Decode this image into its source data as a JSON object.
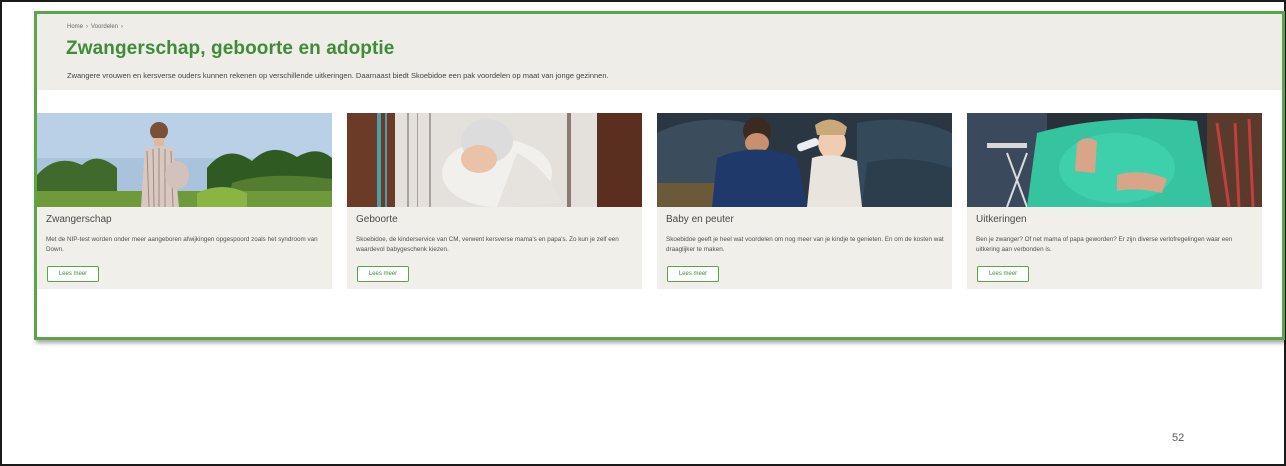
{
  "breadcrumb": {
    "home": "Home",
    "sep1": "›",
    "current": "Voordelen",
    "sep2": "›"
  },
  "page": {
    "title": "Zwangerschap, geboorte en adoptie",
    "intro": "Zwangere vrouwen en kersverse ouders kunnen rekenen op verschillende uitkeringen. Daarnaast biedt Skoebidoe een pak voordelen op maat van jonge gezinnen."
  },
  "cards": [
    {
      "title": "Zwangerschap",
      "text": "Met de NIP-test worden onder meer aangeboren afwijkingen opgespoord zoals het syndroom van Down.",
      "button": "Lees meer"
    },
    {
      "title": "Geboorte",
      "text": "Skoebidoe, de kinderservice van CM, verwent kersverse mama's en papa's. Zo kun je zelf een waardevol babygeschenk kiezen.",
      "button": "Lees meer"
    },
    {
      "title": "Baby en peuter",
      "text": "Skoebidoe geeft je heel wat voordelen om nog meer van je kindje te genieten. En om de kosten wat draaglijker te maken.",
      "button": "Lees meer"
    },
    {
      "title": "Uitkeringen",
      "text": "Ben je zwanger? Of net mama of papa geworden? Er zijn diverse verlofregelingen waar een uitkering aan verbonden is.",
      "button": "Lees meer"
    }
  ],
  "slide": {
    "page_number": "52"
  },
  "colors": {
    "accent": "#3f8b3a",
    "frame": "#5aa449",
    "hero_bg": "#efede7",
    "card_bg": "#f1efea"
  }
}
